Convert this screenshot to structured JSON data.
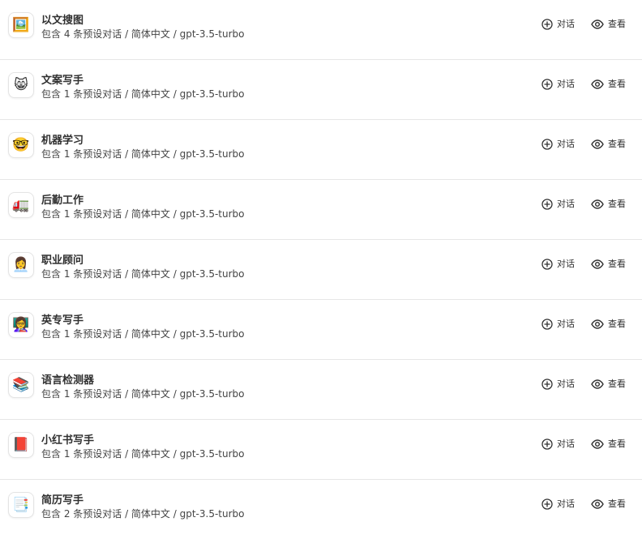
{
  "actions": {
    "chat_label": "对话",
    "view_label": "查看"
  },
  "masks": [
    {
      "emoji": "🖼️",
      "icon": "framed-picture-icon",
      "name": "以文搜图",
      "meta": "包含 4 条预设对话 / 简体中文 / gpt-3.5-turbo"
    },
    {
      "emoji": "😸",
      "icon": "grinning-cat-icon",
      "name": "文案写手",
      "meta": "包含 1 条预设对话 / 简体中文 / gpt-3.5-turbo"
    },
    {
      "emoji": "🤓",
      "icon": "nerd-face-icon",
      "name": "机器学习",
      "meta": "包含 1 条预设对话 / 简体中文 / gpt-3.5-turbo"
    },
    {
      "emoji": "🚛",
      "icon": "delivery-truck-icon",
      "name": "后勤工作",
      "meta": "包含 1 条预设对话 / 简体中文 / gpt-3.5-turbo"
    },
    {
      "emoji": "👩‍💼",
      "icon": "office-worker-icon",
      "name": "职业顾问",
      "meta": "包含 1 条预设对话 / 简体中文 / gpt-3.5-turbo"
    },
    {
      "emoji": "👩‍🏫",
      "icon": "teacher-icon",
      "name": "英专写手",
      "meta": "包含 1 条预设对话 / 简体中文 / gpt-3.5-turbo"
    },
    {
      "emoji": "📚",
      "icon": "books-icon",
      "name": "语言检测器",
      "meta": "包含 1 条预设对话 / 简体中文 / gpt-3.5-turbo"
    },
    {
      "emoji": "📕",
      "icon": "red-book-icon",
      "name": "小红书写手",
      "meta": "包含 1 条预设对话 / 简体中文 / gpt-3.5-turbo"
    },
    {
      "emoji": "📑",
      "icon": "bookmark-tabs-icon",
      "name": "简历写手",
      "meta": "包含 2 条预设对话 / 简体中文 / gpt-3.5-turbo"
    }
  ]
}
